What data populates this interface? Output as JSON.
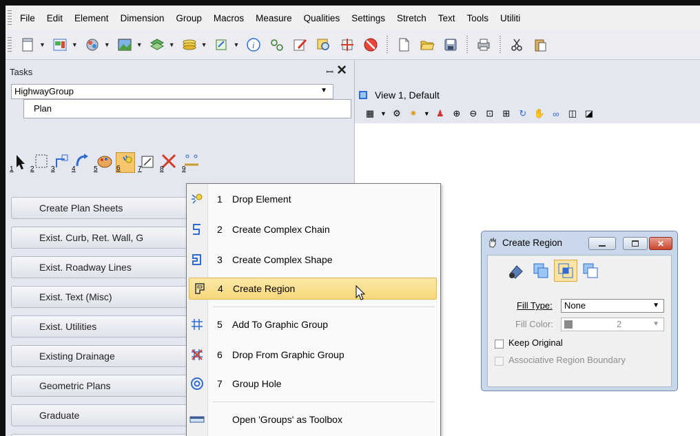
{
  "menubar": {
    "items": [
      "File",
      "Edit",
      "Element",
      "Dimension",
      "Group",
      "Macros",
      "Measure",
      "Qualities",
      "Settings",
      "Stretch",
      "Text",
      "Tools",
      "Utiliti"
    ]
  },
  "toolbar": {
    "icons": [
      "new-file-icon",
      "element-info-icon",
      "render-icon",
      "display-icon",
      "levels-icon",
      "layers-icon",
      "attach-icon",
      "info-icon",
      "select-icon",
      "edit-icon",
      "search-icon",
      "snap-icon",
      "cancel-icon",
      "new-icon",
      "open-folder-icon",
      "save-icon",
      "print-icon",
      "cut-icon",
      "paste-icon"
    ]
  },
  "tasks": {
    "title": "Tasks",
    "pin": "⎕",
    "close": "✕",
    "group_combo": "HighwayGroup",
    "plan_label": "Plan",
    "tool_numbers": [
      "1",
      "2",
      "3",
      "4",
      "5",
      "6",
      "7",
      "8",
      "9"
    ],
    "buttons": [
      "Create Plan Sheets",
      "Exist. Curb, Ret. Wall, G",
      "Exist. Roadway Lines",
      "Exist. Text (Misc)",
      "Exist. Utilities",
      "Existing Drainage",
      "Geometric Plans",
      "Graduate"
    ]
  },
  "view": {
    "title": "View 1, Default"
  },
  "popup_menu": {
    "items": [
      {
        "num": "1",
        "label": "Drop Element",
        "icon": "drop-element-icon"
      },
      {
        "num": "2",
        "label": "Create Complex Chain",
        "icon": "complex-chain-icon"
      },
      {
        "num": "3",
        "label": "Create Complex Shape",
        "icon": "complex-shape-icon"
      },
      {
        "num": "4",
        "label": "Create Region",
        "icon": "create-region-icon",
        "highlighted": true
      },
      {
        "num": "5",
        "label": "Add To Graphic Group",
        "icon": "add-graphic-group-icon"
      },
      {
        "num": "6",
        "label": "Drop From Graphic Group",
        "icon": "drop-graphic-group-icon"
      },
      {
        "num": "7",
        "label": "Group Hole",
        "icon": "group-hole-icon"
      },
      {
        "num": "",
        "label": "Open 'Groups' as Toolbox",
        "icon": "toolbox-icon"
      }
    ]
  },
  "dialog": {
    "title": "Create Region",
    "fill_type_label": "Fill Type:",
    "fill_type_value": "None",
    "fill_color_label": "Fill Color:",
    "fill_color_value": "2",
    "keep_original_label": "Keep Original",
    "associative_label": "Associative Region Boundary"
  },
  "colors": {
    "highlight": "#f6d77c",
    "dialog_frame": "#c9d7ea",
    "panel": "#e4e7ef"
  }
}
